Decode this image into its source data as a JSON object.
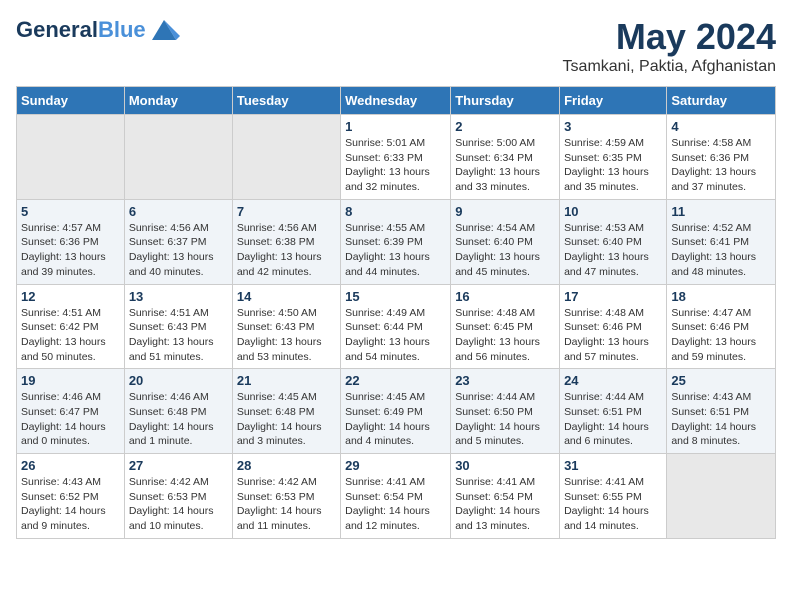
{
  "header": {
    "logo_line1": "General",
    "logo_line2": "Blue",
    "month": "May 2024",
    "location": "Tsamkani, Paktia, Afghanistan"
  },
  "weekdays": [
    "Sunday",
    "Monday",
    "Tuesday",
    "Wednesday",
    "Thursday",
    "Friday",
    "Saturday"
  ],
  "weeks": [
    [
      {
        "day": "",
        "info": ""
      },
      {
        "day": "",
        "info": ""
      },
      {
        "day": "",
        "info": ""
      },
      {
        "day": "1",
        "info": "Sunrise: 5:01 AM\nSunset: 6:33 PM\nDaylight: 13 hours\nand 32 minutes."
      },
      {
        "day": "2",
        "info": "Sunrise: 5:00 AM\nSunset: 6:34 PM\nDaylight: 13 hours\nand 33 minutes."
      },
      {
        "day": "3",
        "info": "Sunrise: 4:59 AM\nSunset: 6:35 PM\nDaylight: 13 hours\nand 35 minutes."
      },
      {
        "day": "4",
        "info": "Sunrise: 4:58 AM\nSunset: 6:36 PM\nDaylight: 13 hours\nand 37 minutes."
      }
    ],
    [
      {
        "day": "5",
        "info": "Sunrise: 4:57 AM\nSunset: 6:36 PM\nDaylight: 13 hours\nand 39 minutes."
      },
      {
        "day": "6",
        "info": "Sunrise: 4:56 AM\nSunset: 6:37 PM\nDaylight: 13 hours\nand 40 minutes."
      },
      {
        "day": "7",
        "info": "Sunrise: 4:56 AM\nSunset: 6:38 PM\nDaylight: 13 hours\nand 42 minutes."
      },
      {
        "day": "8",
        "info": "Sunrise: 4:55 AM\nSunset: 6:39 PM\nDaylight: 13 hours\nand 44 minutes."
      },
      {
        "day": "9",
        "info": "Sunrise: 4:54 AM\nSunset: 6:40 PM\nDaylight: 13 hours\nand 45 minutes."
      },
      {
        "day": "10",
        "info": "Sunrise: 4:53 AM\nSunset: 6:40 PM\nDaylight: 13 hours\nand 47 minutes."
      },
      {
        "day": "11",
        "info": "Sunrise: 4:52 AM\nSunset: 6:41 PM\nDaylight: 13 hours\nand 48 minutes."
      }
    ],
    [
      {
        "day": "12",
        "info": "Sunrise: 4:51 AM\nSunset: 6:42 PM\nDaylight: 13 hours\nand 50 minutes."
      },
      {
        "day": "13",
        "info": "Sunrise: 4:51 AM\nSunset: 6:43 PM\nDaylight: 13 hours\nand 51 minutes."
      },
      {
        "day": "14",
        "info": "Sunrise: 4:50 AM\nSunset: 6:43 PM\nDaylight: 13 hours\nand 53 minutes."
      },
      {
        "day": "15",
        "info": "Sunrise: 4:49 AM\nSunset: 6:44 PM\nDaylight: 13 hours\nand 54 minutes."
      },
      {
        "day": "16",
        "info": "Sunrise: 4:48 AM\nSunset: 6:45 PM\nDaylight: 13 hours\nand 56 minutes."
      },
      {
        "day": "17",
        "info": "Sunrise: 4:48 AM\nSunset: 6:46 PM\nDaylight: 13 hours\nand 57 minutes."
      },
      {
        "day": "18",
        "info": "Sunrise: 4:47 AM\nSunset: 6:46 PM\nDaylight: 13 hours\nand 59 minutes."
      }
    ],
    [
      {
        "day": "19",
        "info": "Sunrise: 4:46 AM\nSunset: 6:47 PM\nDaylight: 14 hours\nand 0 minutes."
      },
      {
        "day": "20",
        "info": "Sunrise: 4:46 AM\nSunset: 6:48 PM\nDaylight: 14 hours\nand 1 minute."
      },
      {
        "day": "21",
        "info": "Sunrise: 4:45 AM\nSunset: 6:48 PM\nDaylight: 14 hours\nand 3 minutes."
      },
      {
        "day": "22",
        "info": "Sunrise: 4:45 AM\nSunset: 6:49 PM\nDaylight: 14 hours\nand 4 minutes."
      },
      {
        "day": "23",
        "info": "Sunrise: 4:44 AM\nSunset: 6:50 PM\nDaylight: 14 hours\nand 5 minutes."
      },
      {
        "day": "24",
        "info": "Sunrise: 4:44 AM\nSunset: 6:51 PM\nDaylight: 14 hours\nand 6 minutes."
      },
      {
        "day": "25",
        "info": "Sunrise: 4:43 AM\nSunset: 6:51 PM\nDaylight: 14 hours\nand 8 minutes."
      }
    ],
    [
      {
        "day": "26",
        "info": "Sunrise: 4:43 AM\nSunset: 6:52 PM\nDaylight: 14 hours\nand 9 minutes."
      },
      {
        "day": "27",
        "info": "Sunrise: 4:42 AM\nSunset: 6:53 PM\nDaylight: 14 hours\nand 10 minutes."
      },
      {
        "day": "28",
        "info": "Sunrise: 4:42 AM\nSunset: 6:53 PM\nDaylight: 14 hours\nand 11 minutes."
      },
      {
        "day": "29",
        "info": "Sunrise: 4:41 AM\nSunset: 6:54 PM\nDaylight: 14 hours\nand 12 minutes."
      },
      {
        "day": "30",
        "info": "Sunrise: 4:41 AM\nSunset: 6:54 PM\nDaylight: 14 hours\nand 13 minutes."
      },
      {
        "day": "31",
        "info": "Sunrise: 4:41 AM\nSunset: 6:55 PM\nDaylight: 14 hours\nand 14 minutes."
      },
      {
        "day": "",
        "info": ""
      }
    ]
  ]
}
